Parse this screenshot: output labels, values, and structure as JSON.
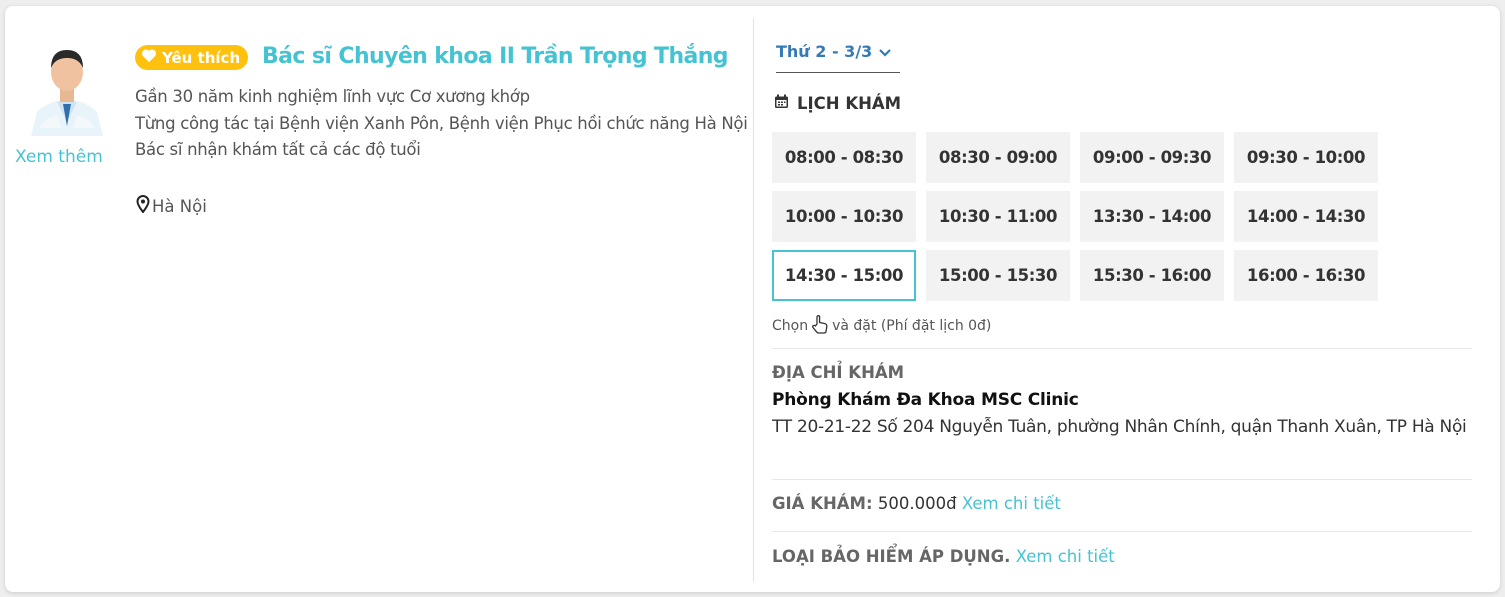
{
  "doctor": {
    "favorite_label": "Yêu thích",
    "name": "Bác sĩ Chuyên khoa II Trần Trọng Thắng",
    "see_more": "Xem thêm",
    "description_lines": [
      "Gần 30 năm kinh nghiệm lĩnh vực Cơ xương khớp",
      "Từng công tác tại Bệnh viện Xanh Pôn, Bệnh viện Phục hồi chức năng Hà Nội",
      "Bác sĩ nhận khám tất cả các độ tuổi"
    ],
    "location": "Hà Nội"
  },
  "schedule": {
    "day_selected": "Thứ 2 - 3/3",
    "title": "LỊCH KHÁM",
    "slots": [
      "08:00 - 08:30",
      "08:30 - 09:00",
      "09:00 - 09:30",
      "09:30 - 10:00",
      "10:00 - 10:30",
      "10:30 - 11:00",
      "13:30 - 14:00",
      "14:00 - 14:30",
      "14:30 - 15:00",
      "15:00 - 15:30",
      "15:30 - 16:00",
      "16:00 - 16:30"
    ],
    "selected_slot": "14:30 - 15:00",
    "choose_prefix": "Chọn",
    "choose_suffix": "và đặt (Phí đặt lịch 0đ)"
  },
  "address": {
    "title": "ĐỊA CHỈ KHÁM",
    "clinic_name": "Phòng Khám Đa Khoa MSC Clinic",
    "clinic_address": "TT 20-21-22 Số 204 Nguyễn Tuân, phường Nhân Chính, quận Thanh Xuân, TP Hà Nội"
  },
  "price": {
    "label": "GIÁ KHÁM:",
    "value": "500.000đ",
    "link": "Xem chi tiết"
  },
  "insurance": {
    "label": "LOẠI BẢO HIỂM ÁP DỤNG.",
    "link": "Xem chi tiết"
  },
  "colors": {
    "accent": "#45c3d2",
    "favorite_badge": "#ffc10e",
    "day_select": "#337ab7"
  },
  "icons": {
    "favorite": "heart-icon",
    "location": "map-pin-icon",
    "calendar": "calendar-icon",
    "dropdown": "chevron-down-icon",
    "hand": "pointer-hand-icon"
  }
}
